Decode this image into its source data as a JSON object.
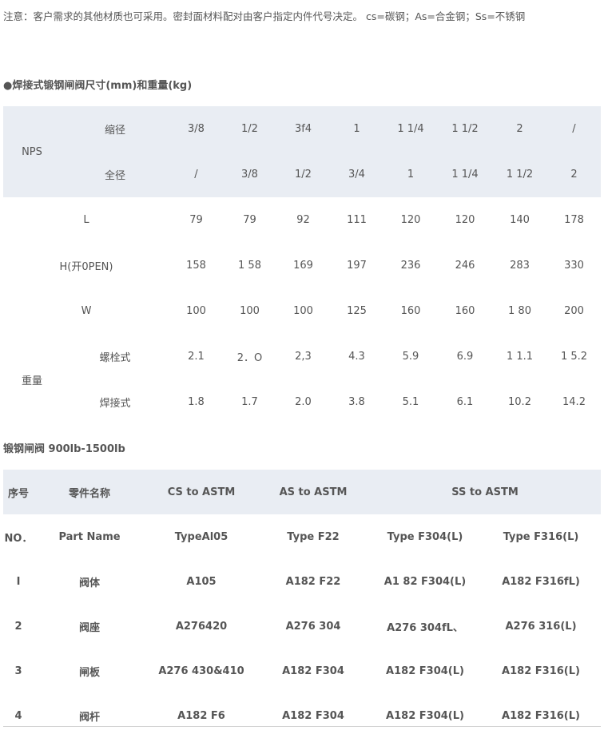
{
  "note": "注意：客户需求的其他材质也可采用。密封面材料配对由客户指定内件代号决定。 cs=碳钢；As=合金钢；Ss=不锈钢",
  "section1": {
    "title": "●焊接式锻钢闸阀尺寸(mm)和重量(kg)",
    "nps_label": "NPS",
    "reduced_label": "缩径",
    "full_label": "全径",
    "reduced_values": [
      "3/8",
      "1/2",
      "3f4",
      "1",
      "1 1/4",
      "1 1/2",
      "2",
      "/"
    ],
    "full_values": [
      "/",
      "3/8",
      "1/2",
      "3/4",
      "1",
      "1 1/4",
      "1 1/2",
      "2"
    ],
    "rows": [
      {
        "label": "L",
        "values": [
          "79",
          "79",
          "92",
          "111",
          "120",
          "120",
          "140",
          "178"
        ]
      },
      {
        "label": "H(开0PEN)",
        "values": [
          "158",
          "1 58",
          "169",
          "197",
          "236",
          "246",
          "283",
          "330"
        ]
      },
      {
        "label": "W",
        "values": [
          "100",
          "100",
          "100",
          "125",
          "160",
          "160",
          "1 80",
          "200"
        ]
      }
    ],
    "weight_label": "重量",
    "bolted_label": "螺栓式",
    "bolted_values": [
      "2.1",
      "2．O",
      "2,3",
      "4.3",
      "5.9",
      "6.9",
      "1 1.1",
      "1 5.2"
    ],
    "welded_label": "焊接式",
    "welded_values": [
      "1.8",
      "1.7",
      "2.0",
      "3.8",
      "5.1",
      "6.1",
      "10.2",
      "14.2"
    ]
  },
  "section2": {
    "title": "锻钢闸阀 900lb-1500lb",
    "header": [
      "序号",
      "零件名称",
      "CS to ASTM",
      "AS to ASTM",
      "SS to ASTM"
    ],
    "subheader": [
      "NO．",
      "Part Name",
      "TypeAl05",
      "Type F22",
      "Type F304(L)",
      "Type F316(L)"
    ],
    "rows": [
      [
        "I",
        "阀体",
        "A105",
        "A182 F22",
        "A1 82 F304(L)",
        "A182 F316fL)"
      ],
      [
        "2",
        "阀座",
        "A276420",
        "A276 304",
        "A276 304fL、",
        "A276 316(L)"
      ],
      [
        "3",
        "闸板",
        "A276 430&410",
        "A182 F304",
        "A182 F304(L)",
        "A182 F316(L)"
      ],
      [
        "4",
        "阀杆",
        "A182 F6",
        "A182 F304",
        "A182 F304(L)",
        "A182 F316(L)"
      ]
    ]
  }
}
